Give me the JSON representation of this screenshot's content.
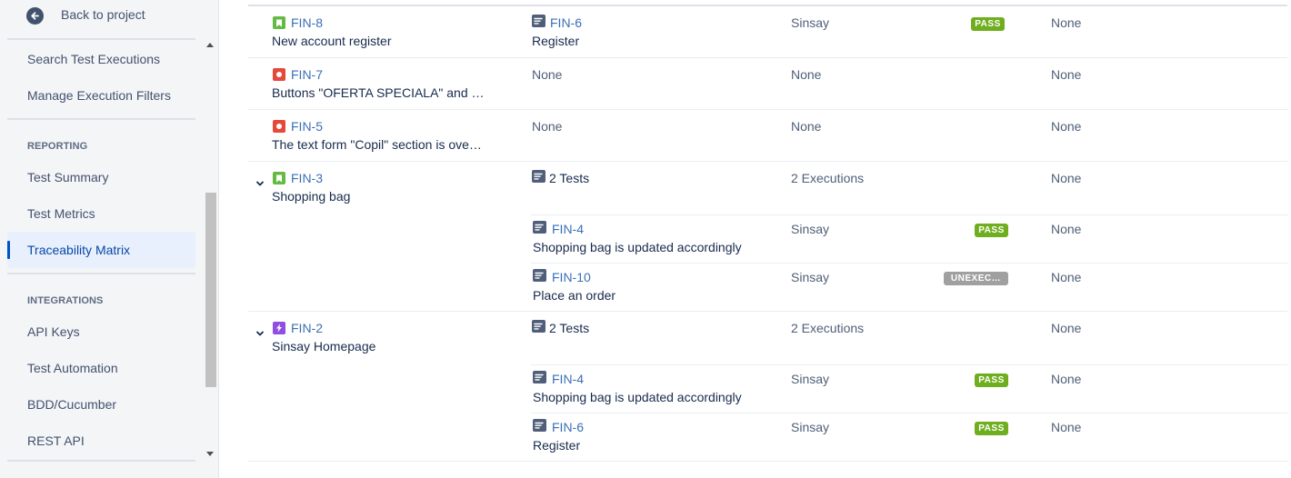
{
  "sidebar": {
    "back_label": "Back to project",
    "items_top": [
      {
        "label": "Search Test Executions"
      },
      {
        "label": "Manage Execution Filters"
      }
    ],
    "reporting": {
      "label": "REPORTING",
      "items": [
        {
          "label": "Test Summary"
        },
        {
          "label": "Test Metrics"
        },
        {
          "label": "Traceability Matrix"
        }
      ]
    },
    "integrations": {
      "label": "INTEGRATIONS",
      "items": [
        {
          "label": "API Keys"
        },
        {
          "label": "Test Automation"
        },
        {
          "label": "BDD/Cucumber"
        },
        {
          "label": "REST API"
        }
      ]
    }
  },
  "matrix": {
    "rows": [
      {
        "key": "FIN-8",
        "summary": "New account register",
        "type": "story",
        "test_key": "FIN-6",
        "test_summary": "Register",
        "execution": "Sinsay",
        "status": "PASS",
        "defects": "None"
      },
      {
        "key": "FIN-7",
        "summary": "Buttons \"OFERTA SPECIALA\" and …",
        "type": "bug",
        "test": "None",
        "execution": "None",
        "defects": "None"
      },
      {
        "key": "FIN-5",
        "summary": "The text form \"Copil\" section is ove…",
        "type": "bug",
        "test": "None",
        "execution": "None",
        "defects": "None"
      },
      {
        "key": "FIN-3",
        "summary": "Shopping bag",
        "type": "story",
        "tests_count": "2 Tests",
        "executions_count": "2 Executions",
        "defects": "None",
        "children": [
          {
            "test_key": "FIN-4",
            "test_summary": "Shopping bag is updated accordingly",
            "execution": "Sinsay",
            "status": "PASS",
            "defects": "None"
          },
          {
            "test_key": "FIN-10",
            "test_summary": "Place an order",
            "execution": "Sinsay",
            "status": "UNEXEC…",
            "defects": "None"
          }
        ]
      },
      {
        "key": "FIN-2",
        "summary": "Sinsay Homepage",
        "type": "epic",
        "tests_count": "2 Tests",
        "executions_count": "2 Executions",
        "defects": "None",
        "children": [
          {
            "test_key": "FIN-4",
            "test_summary": "Shopping bag is updated accordingly",
            "execution": "Sinsay",
            "status": "PASS",
            "defects": "None"
          },
          {
            "test_key": "FIN-6",
            "test_summary": "Register",
            "execution": "Sinsay",
            "status": "PASS",
            "defects": "None"
          }
        ]
      }
    ]
  },
  "colors": {
    "link": "#3b6fb6",
    "pass": "#6fae1e",
    "unexecuted": "#a0a0a0",
    "story": "#65ba43",
    "bug": "#e5493a",
    "epic": "#904ee2",
    "active_nav": "#0747a6"
  }
}
